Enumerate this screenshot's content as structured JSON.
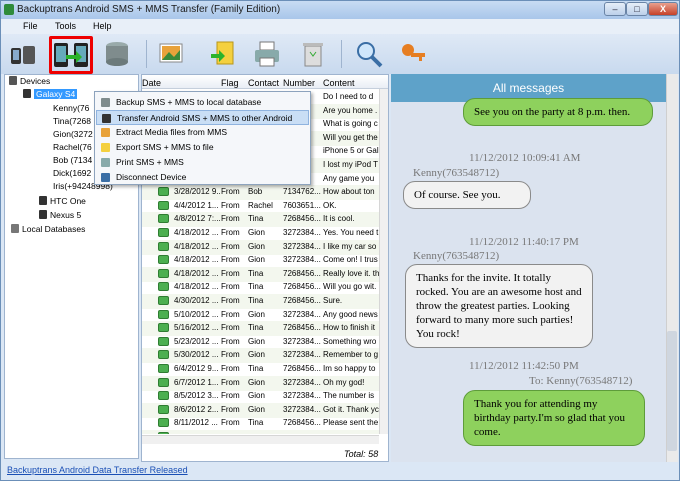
{
  "window": {
    "title": "Backuptrans Android SMS + MMS Transfer (Family Edition)",
    "min": "–",
    "max": "□",
    "close": "X"
  },
  "menu": [
    "File",
    "Tools",
    "Help"
  ],
  "tree": {
    "root": "Devices",
    "device": "Galaxy S4",
    "contacts": [
      "Kenny(76",
      "Tina(7268",
      "Gion(3272",
      "Rachel(76",
      "Bob (7134",
      "Dick(1692",
      "Iris(+94248998)"
    ],
    "other_devices": [
      "HTC One",
      "Nexus 5"
    ],
    "local": "Local Databases"
  },
  "grid": {
    "headers": [
      "Date",
      "Flag",
      "Contact",
      "Number",
      "Content"
    ],
    "rows": [
      {
        "date": "",
        "flag": "",
        "contact": "",
        "number": "",
        "content": "Do I need to d"
      },
      {
        "date": "",
        "flag": "",
        "contact": "",
        "number": "",
        "content": "Are you home ."
      },
      {
        "date": "",
        "flag": "",
        "contact": "",
        "number": "",
        "content": "What is going c"
      },
      {
        "date": "",
        "flag": "",
        "contact": "",
        "number": "",
        "content": "Will you get the"
      },
      {
        "date": "",
        "flag": "",
        "contact": "",
        "number": "",
        "content": "iPhone 5 or Gal"
      },
      {
        "date": "",
        "flag": "",
        "contact": "",
        "number": "",
        "content": "I lost my iPod T"
      },
      {
        "date": "",
        "flag": "",
        "contact": "",
        "number": "",
        "content": "Any game you"
      },
      {
        "date": "3/28/2012 9...",
        "flag": "From",
        "contact": "Bob",
        "number": "7134762...",
        "content": "How about ton"
      },
      {
        "date": "4/4/2012 1...",
        "flag": "From",
        "contact": "Rachel",
        "number": "7603651...",
        "content": "OK."
      },
      {
        "date": "4/8/2012 7:...",
        "flag": "From",
        "contact": "Tina",
        "number": "7268456...",
        "content": "It is cool."
      },
      {
        "date": "4/18/2012 ...",
        "flag": "From",
        "contact": "Gion",
        "number": "3272384...",
        "content": "Yes. You need t."
      },
      {
        "date": "4/18/2012 ...",
        "flag": "From",
        "contact": "Gion",
        "number": "3272384...",
        "content": "I like my car so"
      },
      {
        "date": "4/18/2012 ...",
        "flag": "From",
        "contact": "Gion",
        "number": "3272384...",
        "content": "Come on! I trus"
      },
      {
        "date": "4/18/2012 ...",
        "flag": "From",
        "contact": "Tina",
        "number": "7268456...",
        "content": "Really love it. th"
      },
      {
        "date": "4/18/2012 ...",
        "flag": "From",
        "contact": "Tina",
        "number": "7268456...",
        "content": "Will you go wit."
      },
      {
        "date": "4/30/2012 ...",
        "flag": "From",
        "contact": "Tina",
        "number": "7268456...",
        "content": "Sure."
      },
      {
        "date": "5/10/2012 ...",
        "flag": "From",
        "contact": "Gion",
        "number": "3272384...",
        "content": "Any good news"
      },
      {
        "date": "5/16/2012 ...",
        "flag": "From",
        "contact": "Tina",
        "number": "7268456...",
        "content": "How to finish it"
      },
      {
        "date": "5/23/2012 ...",
        "flag": "From",
        "contact": "Gion",
        "number": "3272384...",
        "content": "Something wro"
      },
      {
        "date": "5/30/2012 ...",
        "flag": "From",
        "contact": "Gion",
        "number": "3272384...",
        "content": "Remember to g"
      },
      {
        "date": "6/4/2012 9...",
        "flag": "From",
        "contact": "Tina",
        "number": "7268456...",
        "content": "Im so happy to"
      },
      {
        "date": "6/7/2012 1...",
        "flag": "From",
        "contact": "Gion",
        "number": "3272384...",
        "content": "Oh my god!"
      },
      {
        "date": "8/5/2012 3...",
        "flag": "From",
        "contact": "Gion",
        "number": "3272384...",
        "content": "The number is"
      },
      {
        "date": "8/6/2012 2...",
        "flag": "From",
        "contact": "Gion",
        "number": "3272384...",
        "content": "Got it. Thank yc"
      },
      {
        "date": "8/11/2012 ...",
        "flag": "From",
        "contact": "Tina",
        "number": "7268456...",
        "content": "Please sent the"
      },
      {
        "date": "",
        "flag": "",
        "contact": "",
        "number": "",
        "content": ""
      }
    ],
    "total": "Total: 58"
  },
  "context_menu": [
    "Backup SMS + MMS to local database",
    "Transfer Android SMS + MMS to other Android",
    "Extract Media files from MMS",
    "Export SMS + MMS to file",
    "Print SMS + MMS",
    "Disconnect Device"
  ],
  "messages": {
    "header": "All messages",
    "items": [
      {
        "kind": "out",
        "text": "See you on the party at 8 p.m. then."
      },
      {
        "kind": "ts",
        "text": "11/12/2012 10:09:41 AM"
      },
      {
        "kind": "sender",
        "text": "Kenny(763548712)"
      },
      {
        "kind": "in",
        "text": "Of course. See you."
      },
      {
        "kind": "ts",
        "text": "11/12/2012 11:40:17 PM"
      },
      {
        "kind": "sender",
        "text": "Kenny(763548712)"
      },
      {
        "kind": "in",
        "text": "Thanks for the invite. It totally rocked. You are an awesome host and throw the greatest parties. Looking forward to many more such parties! You rock!"
      },
      {
        "kind": "ts",
        "text": "11/12/2012 11:42:50 PM"
      },
      {
        "kind": "to",
        "text": "To: Kenny(763548712)"
      },
      {
        "kind": "out",
        "text": "Thank you for attending my birthday party.I'm so glad that you come."
      }
    ]
  },
  "status": {
    "link": "Backuptrans Android Data Transfer Released"
  },
  "icons": {
    "toolbar": [
      "devices-db-icon",
      "transfer-phones-icon",
      "backup-database-icon",
      "photos-icon",
      "export-file-icon",
      "print-icon",
      "trash-icon",
      "search-icon",
      "keys-icon"
    ]
  },
  "colors": {
    "accent": "#5ea2c9",
    "out_bubble": "#8ed15d",
    "in_bubble": "#f2f2f2",
    "highlight": "#e00000"
  }
}
